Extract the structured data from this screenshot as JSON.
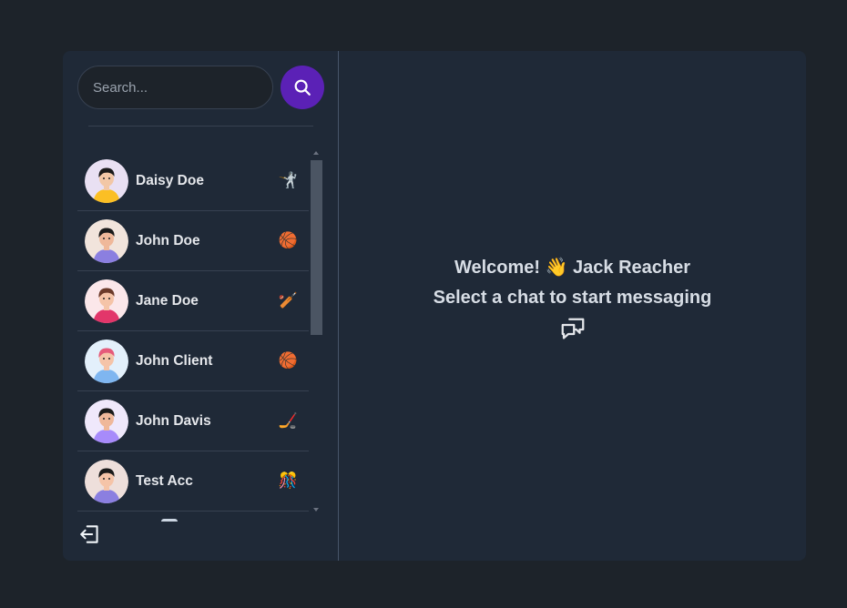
{
  "search": {
    "placeholder": "Search..."
  },
  "conversations": [
    {
      "name": "Daisy Doe",
      "emoji": "🤺",
      "skin": "#f2c7a6",
      "hair": "#1a1a1a",
      "shirt": "#fbbf24",
      "bg": "#e9e0f3"
    },
    {
      "name": "John Doe",
      "emoji": "🏀",
      "skin": "#efb89a",
      "hair": "#1a1a1a",
      "shirt": "#8b7fe0",
      "bg": "#f1e4dc"
    },
    {
      "name": "Jane Doe",
      "emoji": "🏏",
      "skin": "#f5c4a8",
      "hair": "#6b3a2a",
      "shirt": "#e2366a",
      "bg": "#fbe7ea"
    },
    {
      "name": "John Client",
      "emoji": "🏀",
      "skin": "#f5c4a8",
      "hair": "#e55a7a",
      "shirt": "#7fb6f0",
      "bg": "#e3f0fb"
    },
    {
      "name": "John Davis",
      "emoji": "🏒",
      "skin": "#efb89a",
      "hair": "#1a1a1a",
      "shirt": "#a78bfa",
      "bg": "#efe8fb"
    },
    {
      "name": "Test Acc",
      "emoji": "🎊",
      "skin": "#f5c4a8",
      "hair": "#1a1a1a",
      "shirt": "#8b7fe0",
      "bg": "#eedfdb"
    }
  ],
  "welcome": {
    "greeting": "Welcome! 👋 Jack Reacher",
    "prompt": "Select a chat to start messaging"
  },
  "icons": {
    "search": "search-icon",
    "logout": "logout-icon",
    "chat": "chat-bubbles-icon"
  },
  "colors": {
    "accent": "#5b21b6",
    "panel": "#1f2937",
    "background": "#1d232a"
  }
}
